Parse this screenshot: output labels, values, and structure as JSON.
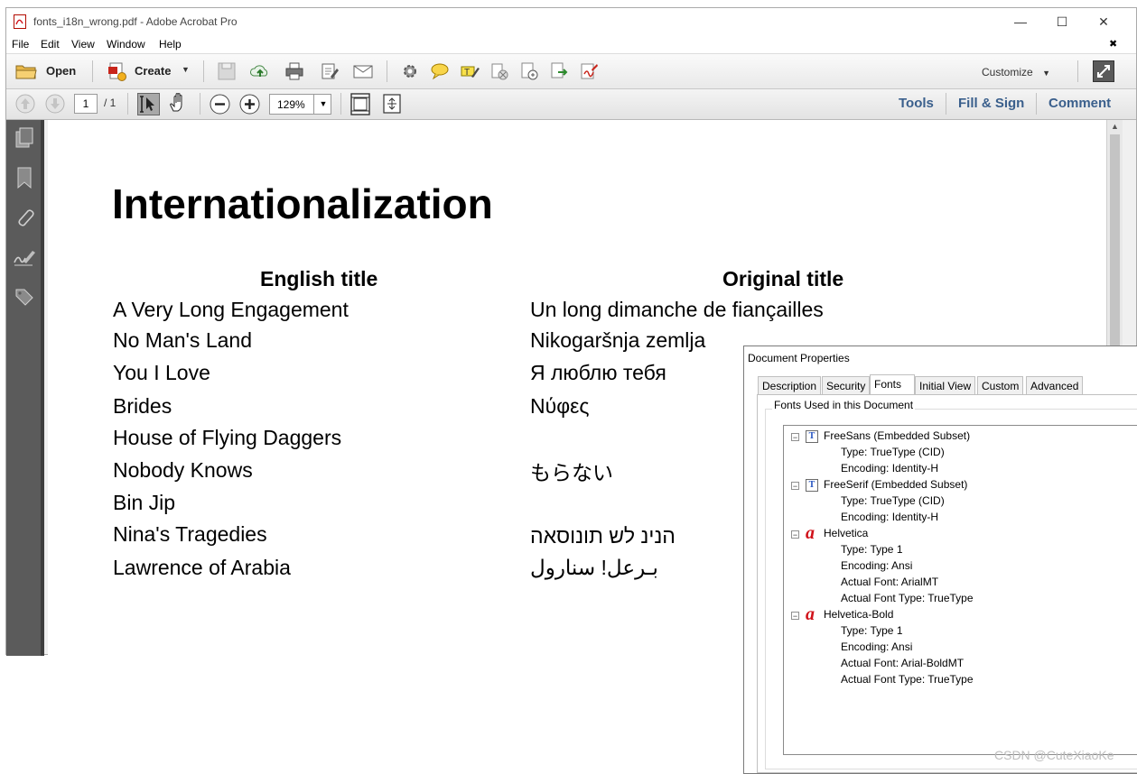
{
  "window": {
    "title": "fonts_i18n_wrong.pdf - Adobe Acrobat Pro",
    "controls": {
      "minimize": "—",
      "maximize": "☐",
      "close": "✕"
    }
  },
  "menubar": {
    "items": [
      "File",
      "Edit",
      "View",
      "Window",
      "Help"
    ],
    "close_doc": "✖"
  },
  "toolbar": {
    "open_label": "Open",
    "create_label": "Create",
    "customize_label": "Customize"
  },
  "nav": {
    "current_page": "1",
    "total_pages": "/ 1",
    "zoom": "129%",
    "tools_label": "Tools",
    "fill_sign_label": "Fill & Sign",
    "comment_label": "Comment"
  },
  "document": {
    "heading": "Internationalization",
    "col_english": "English title",
    "col_original": "Original title",
    "rows": [
      {
        "english": "A Very Long Engagement",
        "original": "Un long dimanche de fiançailles"
      },
      {
        "english": "No Man's Land",
        "original": "Nikogaršnja zemlja"
      },
      {
        "english": "You I Love",
        "original": "Я люблю тебя"
      },
      {
        "english": "Brides",
        "original": "Νύφες"
      },
      {
        "english": "House of Flying Daggers",
        "original": ""
      },
      {
        "english": "Nobody Knows",
        "original": "もらない"
      },
      {
        "english": "Bin Jip",
        "original": ""
      },
      {
        "english": "Nina's Tragedies",
        "original": "הנינ לש תונוסאה"
      },
      {
        "english": "Lawrence of Arabia",
        "original": "بـرعل! سنارول"
      }
    ]
  },
  "dialog": {
    "title": "Document Properties",
    "tabs": [
      "Description",
      "Security",
      "Fonts",
      "Initial View",
      "Custom",
      "Advanced"
    ],
    "active_tab": "Fonts",
    "group_label": "Fonts Used in this Document",
    "fonts": [
      {
        "name": "FreeSans (Embedded Subset)",
        "icon": "truetype-font-icon",
        "props": [
          "Type: TrueType (CID)",
          "Encoding: Identity-H"
        ]
      },
      {
        "name": "FreeSerif (Embedded Subset)",
        "icon": "truetype-font-icon",
        "props": [
          "Type: TrueType (CID)",
          "Encoding: Identity-H"
        ]
      },
      {
        "name": "Helvetica",
        "icon": "type1-font-icon",
        "props": [
          "Type: Type 1",
          "Encoding: Ansi",
          "Actual Font: ArialMT",
          "Actual Font Type: TrueType"
        ]
      },
      {
        "name": "Helvetica-Bold",
        "icon": "type1-font-icon",
        "props": [
          "Type: Type 1",
          "Encoding: Ansi",
          "Actual Font: Arial-BoldMT",
          "Actual Font Type: TrueType"
        ]
      }
    ]
  },
  "watermark": "CSDN @CuteXiaoKe"
}
